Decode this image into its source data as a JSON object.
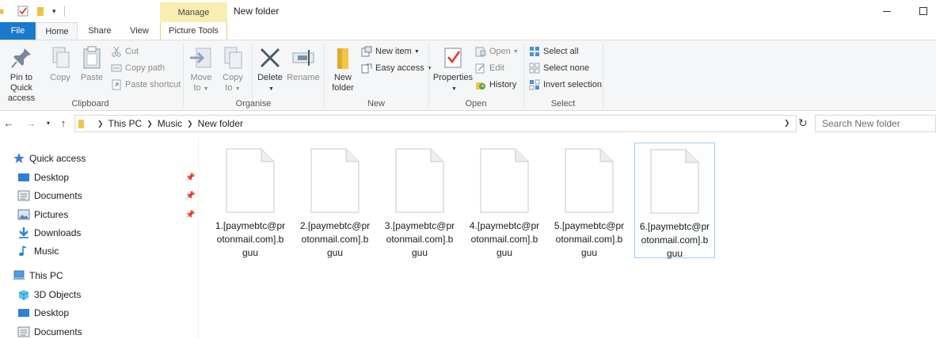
{
  "window": {
    "title": "New folder",
    "context_tab": "Manage"
  },
  "ribbon_tabs": [
    "File",
    "Home",
    "Share",
    "View",
    "Picture Tools"
  ],
  "ribbon": {
    "clipboard": {
      "label": "Clipboard",
      "pin_label_1": "Pin to Quick",
      "pin_label_2": "access",
      "copy": "Copy",
      "paste": "Paste",
      "cut": "Cut",
      "copy_path": "Copy path",
      "paste_shortcut": "Paste shortcut"
    },
    "organise": {
      "label": "Organise",
      "move_1": "Move",
      "move_2": "to",
      "copy_1": "Copy",
      "copy_2": "to",
      "delete": "Delete",
      "rename": "Rename"
    },
    "new": {
      "label": "New",
      "new_folder_1": "New",
      "new_folder_2": "folder",
      "new_item": "New item",
      "easy_access": "Easy access"
    },
    "open": {
      "label": "Open",
      "properties": "Properties",
      "open": "Open",
      "edit": "Edit",
      "history": "History"
    },
    "select": {
      "label": "Select",
      "select_all": "Select all",
      "select_none": "Select none",
      "invert_selection": "Invert selection"
    }
  },
  "address": {
    "crumbs": [
      "This PC",
      "Music",
      "New folder"
    ],
    "search_placeholder": "Search New folder"
  },
  "nav_pane": {
    "quick_access": "Quick access",
    "qa_items": [
      "Desktop",
      "Documents",
      "Pictures",
      "Downloads",
      "Music"
    ],
    "this_pc": "This PC",
    "pc_items": [
      "3D Objects",
      "Desktop",
      "Documents"
    ]
  },
  "files": [
    {
      "line1": "1.[paymebtc@pr",
      "line2": "otonmail.com].b",
      "line3": "guu"
    },
    {
      "line1": "2.[paymebtc@pr",
      "line2": "otonmail.com].b",
      "line3": "guu"
    },
    {
      "line1": "3.[paymebtc@pr",
      "line2": "otonmail.com].b",
      "line3": "guu"
    },
    {
      "line1": "4.[paymebtc@pr",
      "line2": "otonmail.com].b",
      "line3": "guu"
    },
    {
      "line1": "5.[paymebtc@pr",
      "line2": "otonmail.com].b",
      "line3": "guu"
    },
    {
      "line1": "6.[paymebtc@pr",
      "line2": "otonmail.com].b",
      "line3": "guu"
    }
  ],
  "colors": {
    "file_tab": "#1979ca",
    "manage_tab": "#f8eeb0",
    "selection_border": "#99d1ff"
  }
}
